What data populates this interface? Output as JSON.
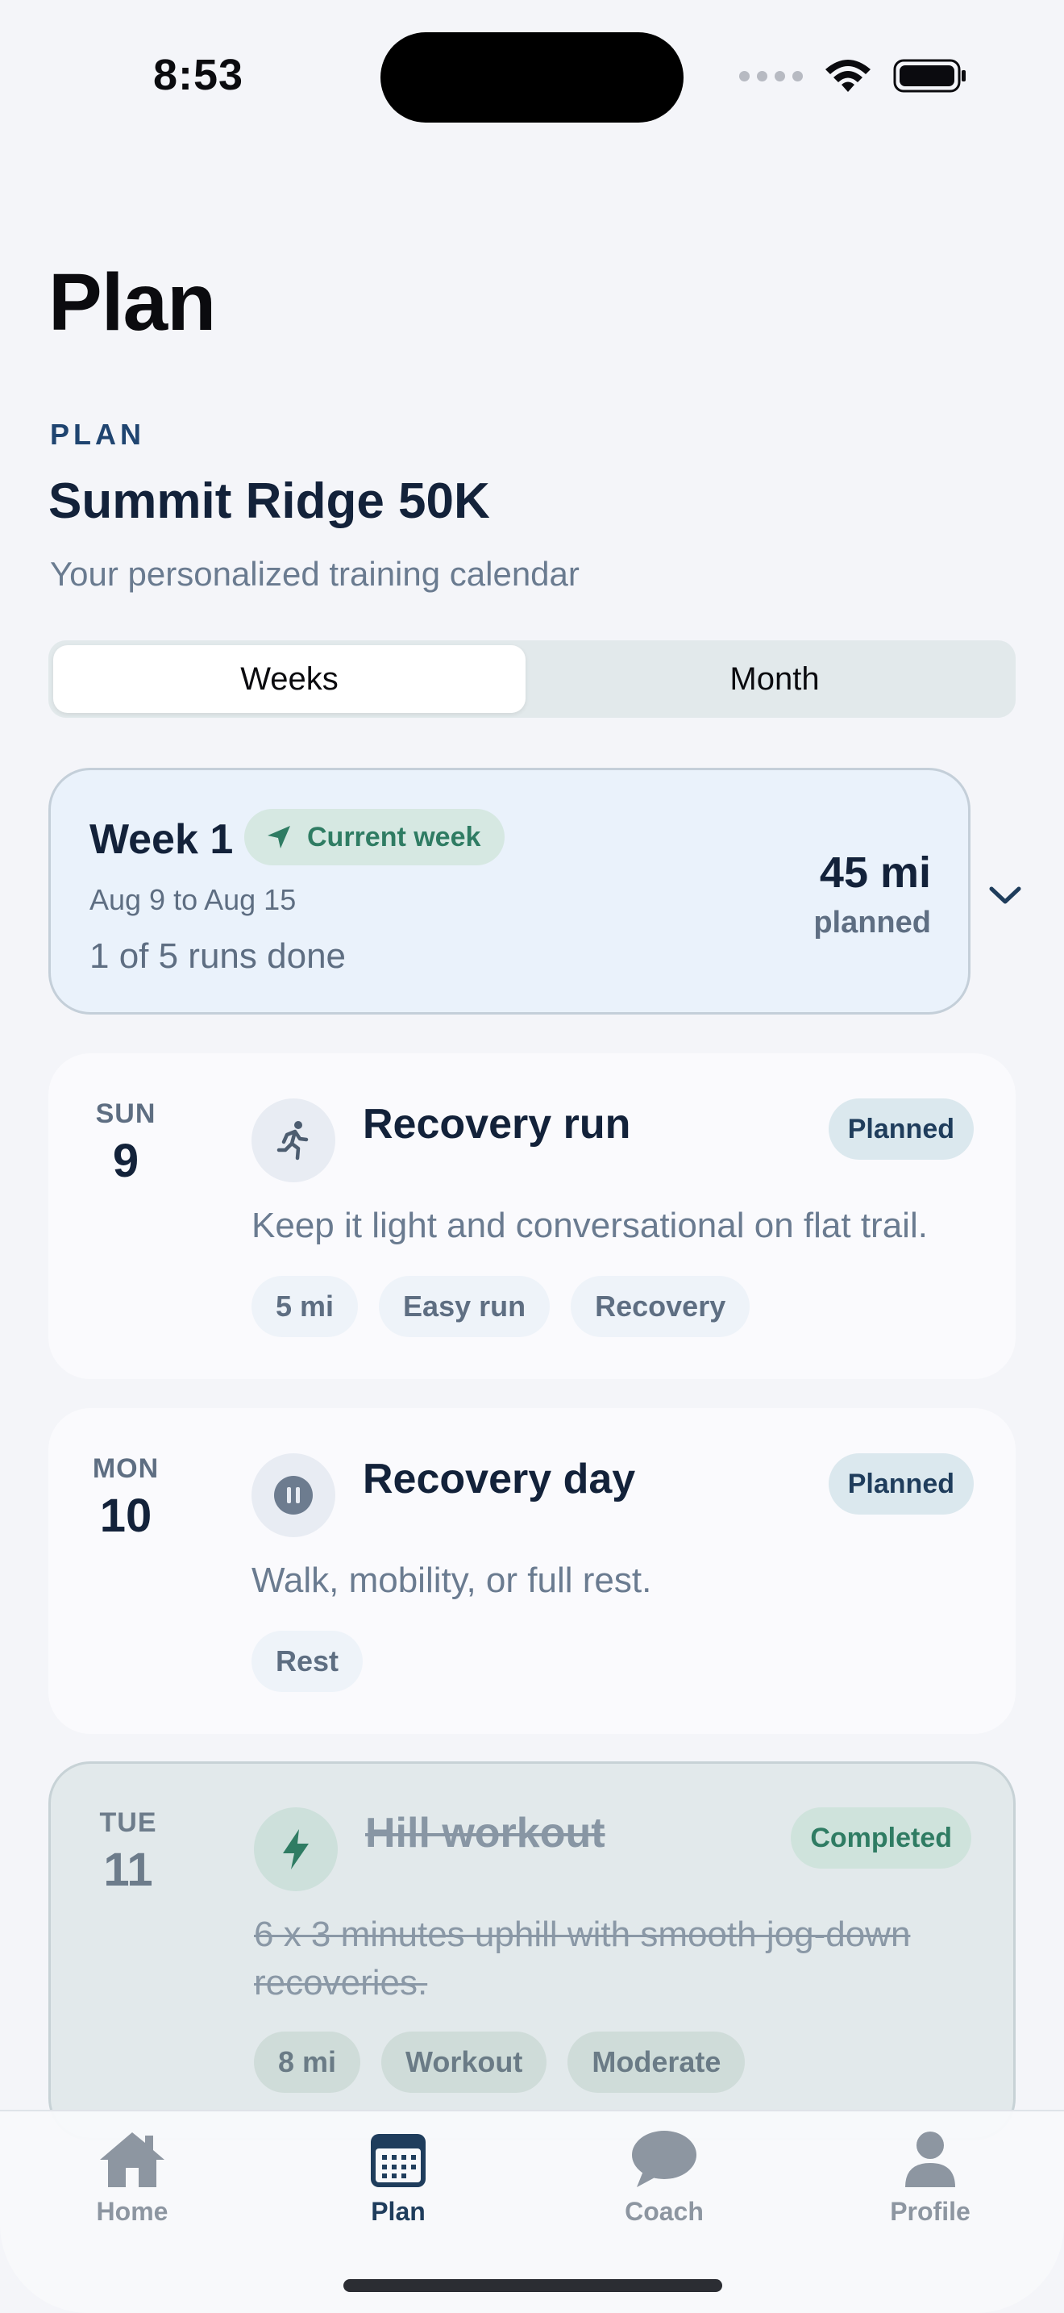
{
  "status": {
    "time": "8:53"
  },
  "header": {
    "title": "Plan",
    "eyebrow": "PLAN",
    "plan_name": "Summit Ridge 50K",
    "subtitle": "Your personalized training calendar"
  },
  "segmented": {
    "options": [
      "Weeks",
      "Month"
    ],
    "selected": "Weeks"
  },
  "week": {
    "title": "Week 1",
    "badge": "Current week",
    "dates": "Aug 9 to Aug 15",
    "progress": "1 of 5 runs done",
    "distance": "45 mi",
    "distance_label": "planned"
  },
  "days": [
    {
      "dow": "SUN",
      "day": "9",
      "icon": "runner-icon",
      "title": "Recovery run",
      "status": "Planned",
      "description": "Keep it light and conversational on flat trail.",
      "tags": [
        "5 mi",
        "Easy run",
        "Recovery"
      ]
    },
    {
      "dow": "MON",
      "day": "10",
      "icon": "pause-icon",
      "title": "Recovery day",
      "status": "Planned",
      "description": "Walk, mobility, or full rest.",
      "tags": [
        "Rest"
      ]
    },
    {
      "dow": "TUE",
      "day": "11",
      "icon": "bolt-icon",
      "title": "Hill workout",
      "status": "Completed",
      "description": "6 x 3 minutes uphill with smooth jog-down recoveries.",
      "tags": [
        "8 mi",
        "Workout",
        "Moderate"
      ]
    }
  ],
  "tabbar": {
    "items": [
      {
        "label": "Home",
        "icon": "home-icon"
      },
      {
        "label": "Plan",
        "icon": "calendar-icon"
      },
      {
        "label": "Coach",
        "icon": "chat-icon"
      },
      {
        "label": "Profile",
        "icon": "person-icon"
      }
    ],
    "active": "Plan"
  },
  "colors": {
    "accent": "#1f3d5c",
    "success": "#2f7c63",
    "background": "#f4f5f9",
    "week_card": "#eaf2fb"
  }
}
